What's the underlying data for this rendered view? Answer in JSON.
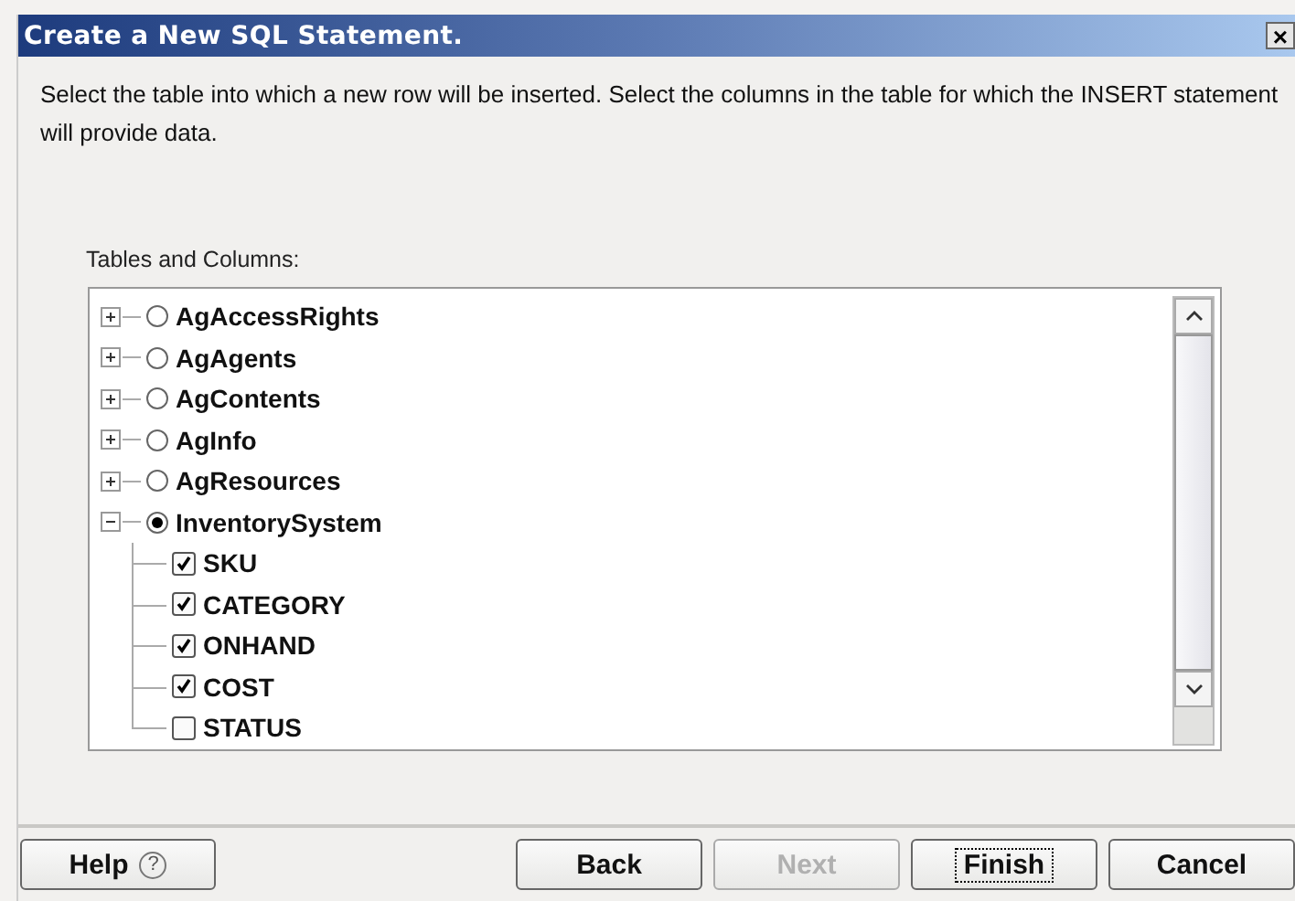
{
  "window": {
    "title": "Create a New SQL Statement.",
    "close": "×"
  },
  "instructions": "Select the table into which a new row will be inserted. Select the columns in the table for which the INSERT statement will provide data.",
  "tree": {
    "label": "Tables and Columns:",
    "items": [
      {
        "name": "AgAccessRights",
        "expanded": false,
        "selected": false
      },
      {
        "name": "AgAgents",
        "expanded": false,
        "selected": false
      },
      {
        "name": "AgContents",
        "expanded": false,
        "selected": false
      },
      {
        "name": "AgInfo",
        "expanded": false,
        "selected": false
      },
      {
        "name": "AgResources",
        "expanded": false,
        "selected": false
      },
      {
        "name": "InventorySystem",
        "expanded": true,
        "selected": true,
        "children": [
          {
            "name": "SKU",
            "checked": true
          },
          {
            "name": "CATEGORY",
            "checked": true
          },
          {
            "name": "ONHAND",
            "checked": true
          },
          {
            "name": "COST",
            "checked": true
          },
          {
            "name": "STATUS",
            "checked": false
          }
        ]
      }
    ]
  },
  "buttons": [
    {
      "label": "Help",
      "help_glyph": "?",
      "disabled": false,
      "focused": false
    },
    {
      "label": "Back",
      "disabled": false,
      "focused": false
    },
    {
      "label": "Next",
      "disabled": true,
      "focused": false
    },
    {
      "label": "Finish",
      "disabled": false,
      "focused": true
    },
    {
      "label": "Cancel",
      "disabled": false,
      "focused": false
    }
  ]
}
